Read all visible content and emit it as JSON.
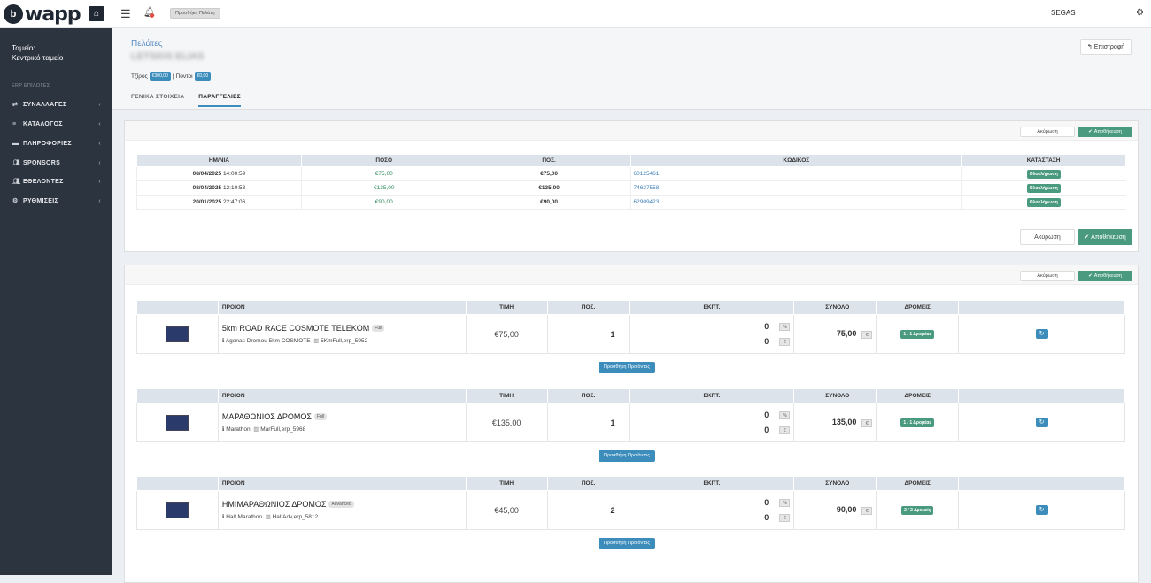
{
  "topbar": {
    "logo_mark": "b",
    "logo_text": "wapp",
    "add_customer_label": "Προσθήκη Πελάτη",
    "user_name": "SEGAS"
  },
  "sidebar": {
    "shop_label": "Ταμείο:",
    "shop_name": "Κεντρικό ταμείο",
    "section_label": "ERP ΕΠΙΛΟΓΕΣ",
    "items": [
      {
        "label": "ΣΥΝΑΛΛΑΓΕΣ",
        "icon": "exchange-icon"
      },
      {
        "label": "ΚΑΤΑΛΟΓΟΣ",
        "icon": "list-icon"
      },
      {
        "label": "ΠΛΗΡΟΦΟΡΙΕΣ",
        "icon": "info-icon"
      },
      {
        "label": "SPONSORS",
        "icon": "users-icon"
      },
      {
        "label": "ΕΘΕΛΟΝΤΕΣ",
        "icon": "users-icon"
      },
      {
        "label": "ΡΥΘΜΙΣΕΙΣ",
        "icon": "gears-icon"
      }
    ]
  },
  "header": {
    "breadcrumb": "Πελάτες",
    "customer_name": "LETSIOS ELIAS",
    "balance_label": "Τζίρος",
    "balance_value": "€300,00",
    "separator": "|",
    "points_label": "Πόντοι",
    "points_value": "€0,00",
    "back_label": "Επιστροφή",
    "tabs": [
      "ΓΕΝΙΚΑ ΣΤΟΙΧΕΙΑ",
      "ΠΑΡΑΓΓΕΛΙΕΣ"
    ]
  },
  "actions": {
    "cancel": "Ακύρωση",
    "save": "Αποθήκευση"
  },
  "orders": {
    "columns": [
      "ΗΜ/ΝΙΑ",
      "ΠΟΣΟ",
      "ΠΟΣ.",
      "ΚΩΔΙΚΟΣ",
      "ΚΑΤΑΣΤΑΣΗ"
    ],
    "rows": [
      {
        "date": "08/04/2025",
        "time": "14:00:59",
        "amount": "€75,00",
        "qty": "€75,00",
        "code": "60125461",
        "status": "Ολοκλήρωση"
      },
      {
        "date": "08/04/2025",
        "time": "12:10:53",
        "amount": "€135,00",
        "qty": "€135,00",
        "code": "74627558",
        "status": "Ολοκλήρωση"
      },
      {
        "date": "20/01/2025",
        "time": "22:47:06",
        "amount": "€90,00",
        "qty": "€90,00",
        "code": "62909423",
        "status": "Ολοκλήρωση"
      }
    ]
  },
  "products": {
    "columns": [
      "ΠΡΟΙΟΝ",
      "ΤΙΜΗ",
      "ΠΟΣ.",
      "ΕΚΠΤ.",
      "ΣΥΝΟΛΟ",
      "ΔΡΟΜΕΙΣ"
    ],
    "add_label": "Προσθήκη Προϊόντος",
    "items": [
      {
        "name": "5km ROAD RACE COSMOTE TELEKOM",
        "badge": "Full",
        "category": "Agonas Dromou 5km COSMOTE",
        "sku": "5KmFull,erp_5952",
        "price": "€75,00",
        "qty": "1",
        "disc_pct": "0",
        "disc_eur": "0",
        "pct_symbol": "%",
        "eur_symbol": "€",
        "total": "75,00",
        "runners": "1 / 1 Δρομέας"
      },
      {
        "name": "ΜΑΡΑΘΩΝΙΟΣ ΔΡΟΜΟΣ",
        "badge": "Full",
        "category": "Marathon",
        "sku": "MarFull,erp_5968",
        "price": "€135,00",
        "qty": "1",
        "disc_pct": "0",
        "disc_eur": "0",
        "pct_symbol": "%",
        "eur_symbol": "€",
        "total": "135,00",
        "runners": "1 / 1 Δρομέας"
      },
      {
        "name": "ΗΜΙΜΑΡΑΘΩΝΙΟΣ ΔΡΟΜΟΣ",
        "badge": "Advanced",
        "category": "Half Marathon",
        "sku": "HalfAdv,erp_5812",
        "price": "€45,00",
        "qty": "2",
        "disc_pct": "0",
        "disc_eur": "0",
        "pct_symbol": "%",
        "eur_symbol": "€",
        "total": "90,00",
        "runners": "2 / 2 Δρομείς"
      }
    ]
  }
}
